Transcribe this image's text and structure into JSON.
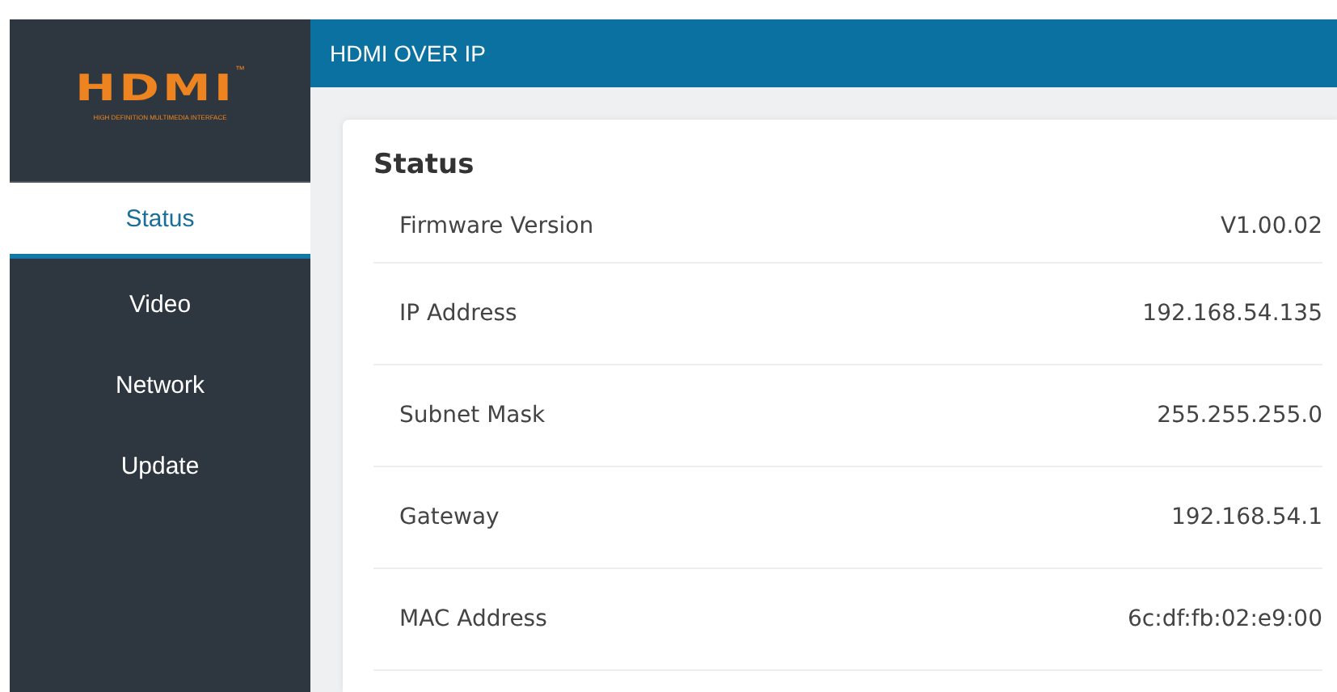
{
  "logo": {
    "wordmark": "HDMI",
    "trademark": "™",
    "tagline": "HIGH DEFINITION MULTIMEDIA INTERFACE"
  },
  "sidebar": {
    "items": [
      {
        "label": "Status",
        "selected": true
      },
      {
        "label": "Video",
        "selected": false
      },
      {
        "label": "Network",
        "selected": false
      },
      {
        "label": "Update",
        "selected": false
      }
    ]
  },
  "header": {
    "title": "HDMI OVER IP"
  },
  "card": {
    "title": "Status",
    "rows": [
      {
        "label": "Firmware Version",
        "value": "V1.00.02"
      },
      {
        "label": "IP Address",
        "value": "192.168.54.135"
      },
      {
        "label": "Subnet Mask",
        "value": "255.255.255.0"
      },
      {
        "label": "Gateway",
        "value": "192.168.54.1"
      },
      {
        "label": "MAC Address",
        "value": "6c:df:fb:02:e9:00"
      }
    ]
  }
}
